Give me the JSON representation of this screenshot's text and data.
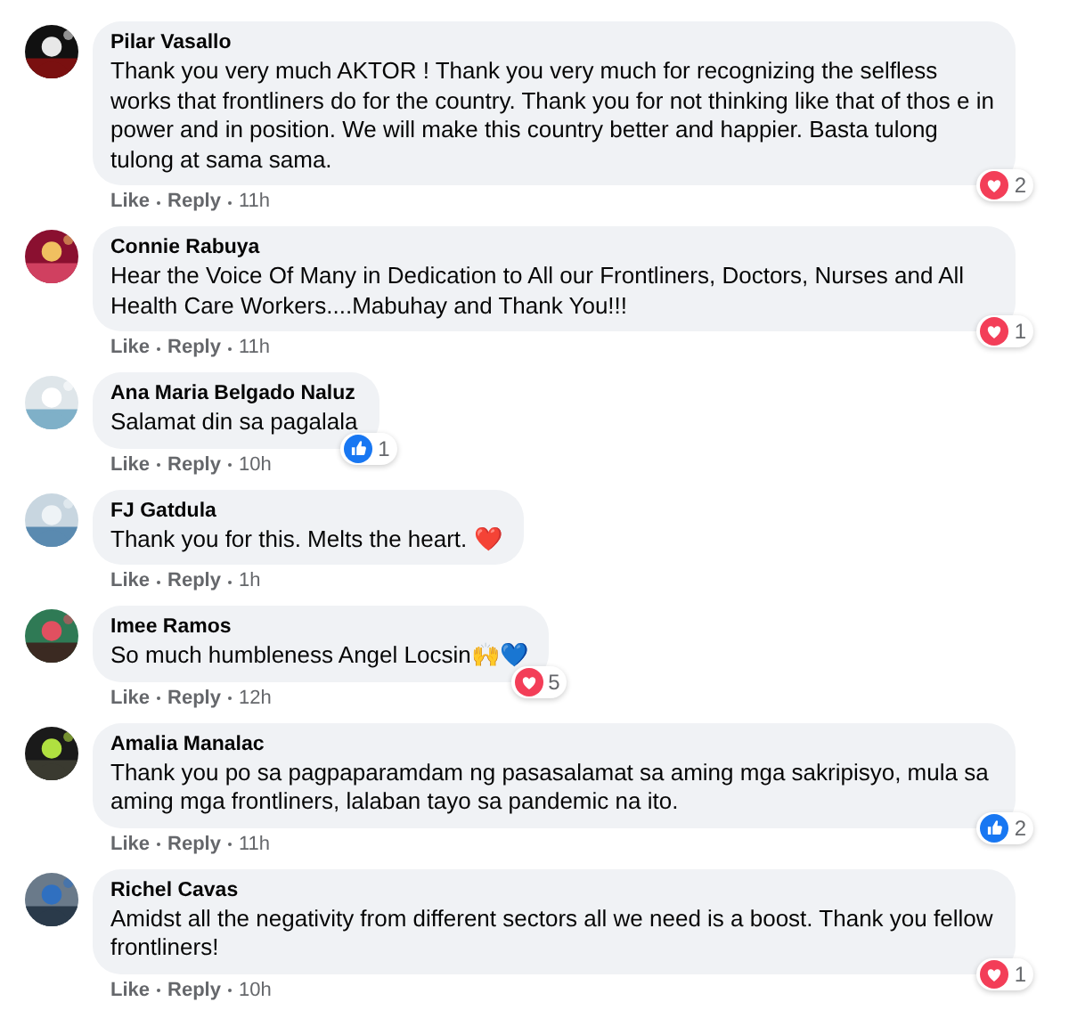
{
  "comments": [
    {
      "author": "Pilar Vasallo",
      "text": "Thank you very much AKTOR ! Thank you very much for recognizing the selfless works that frontliners do for the country. Thank you for not thinking like that of thos e in power and in position. We will make this country better and happier. Basta tulong tulong at sama sama.",
      "like": "Like",
      "reply": "Reply",
      "time": "11h",
      "reaction": {
        "kind": "love",
        "count": "2"
      }
    },
    {
      "author": "Connie Rabuya",
      "text": "Hear the Voice Of Many in Dedication to All our Frontliners, Doctors, Nurses and All Health Care Workers....Mabuhay and Thank You!!!",
      "like": "Like",
      "reply": "Reply",
      "time": "11h",
      "reaction": {
        "kind": "love",
        "count": "1"
      }
    },
    {
      "author": "Ana Maria Belgado Naluz",
      "text": "Salamat din sa pagalala",
      "like": "Like",
      "reply": "Reply",
      "time": "10h",
      "reaction": {
        "kind": "like",
        "count": "1"
      }
    },
    {
      "author": "FJ Gatdula",
      "text": "Thank you for this. Melts the heart. ❤️",
      "like": "Like",
      "reply": "Reply",
      "time": "1h"
    },
    {
      "author": "Imee Ramos",
      "text": "So much humbleness Angel Locsin🙌💙",
      "like": "Like",
      "reply": "Reply",
      "time": "12h",
      "reaction": {
        "kind": "love",
        "count": "5"
      }
    },
    {
      "author": "Amalia Manalac",
      "text": "Thank you po sa pagpaparamdam ng pasasalamat sa aming mga sakripisyo, mula sa aming mga frontliners, lalaban tayo sa pandemic na ito.",
      "like": "Like",
      "reply": "Reply",
      "time": "11h",
      "reaction": {
        "kind": "like",
        "count": "2"
      }
    },
    {
      "author": "Richel Cavas",
      "text": "Amidst all the negativity from different sectors all we need is a boost. Thank you fellow frontliners!",
      "like": "Like",
      "reply": "Reply",
      "time": "10h",
      "reaction": {
        "kind": "love",
        "count": "1"
      }
    }
  ]
}
